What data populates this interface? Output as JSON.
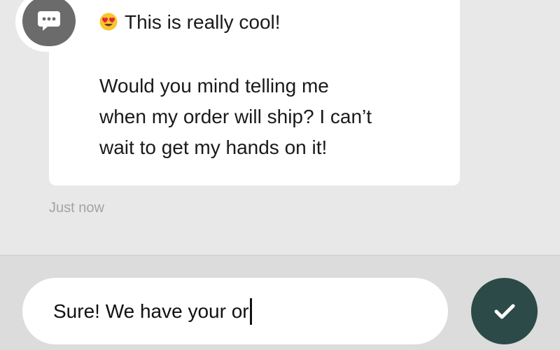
{
  "message": {
    "line1": "This is really cool!",
    "line2": "Would you mind telling me",
    "line3": "when my order will ship? I can’t",
    "line4": "wait to get my hands on it!",
    "emoji": "heart-eyes-emoji-icon",
    "timestamp": "Just now"
  },
  "avatar": {
    "icon": "speech-bubble-icon"
  },
  "composer": {
    "value": "Sure! We have your or",
    "send_icon": "checkmark-icon"
  },
  "colors": {
    "send_button": "#2c4a47",
    "avatar": "#6b6b6b",
    "background": "#e8e8e8",
    "bubble": "#ffffff"
  }
}
